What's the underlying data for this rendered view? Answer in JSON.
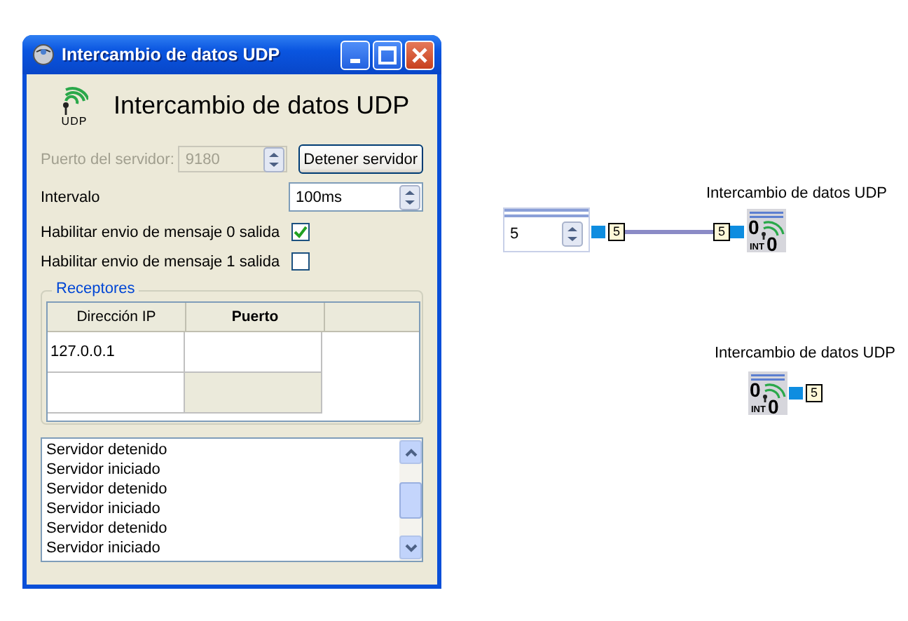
{
  "window": {
    "title": "Intercambio de datos UDP"
  },
  "header": {
    "icon_label": "UDP",
    "title": "Intercambio de datos UDP"
  },
  "server_port": {
    "label": "Puerto del servidor:",
    "value": "9180",
    "disabled": true
  },
  "stop_button": {
    "label": "Detener servidor"
  },
  "interval": {
    "label": "Intervalo",
    "value": "100ms"
  },
  "options": [
    {
      "label": "Habilitar envio de mensaje 0 salida",
      "checked": true
    },
    {
      "label": "Habilitar envio de mensaje 1 salida",
      "checked": false
    }
  ],
  "receivers": {
    "title": "Receptores",
    "columns": [
      {
        "label": "Dirección IP",
        "selected": false
      },
      {
        "label": "Puerto",
        "selected": true
      }
    ],
    "rows": [
      {
        "ip": "127.0.0.1",
        "new": false
      },
      {
        "new": true
      }
    ]
  },
  "log": [
    "Servidor detenido",
    "Servidor iniciado",
    "Servidor detenido",
    "Servidor iniciado",
    "Servidor detenido",
    "Servidor iniciado"
  ],
  "diagram": {
    "numeric_control": {
      "value": "5",
      "tag": "5"
    },
    "blocks": [
      {
        "title": "Intercambio de datos UDP",
        "input_tag": "5",
        "icon_text": [
          "0",
          "INT",
          "0"
        ]
      },
      {
        "title": "Intercambio de datos UDP",
        "output_tag": "5",
        "icon_text": [
          "0",
          "INT",
          "0"
        ]
      }
    ]
  }
}
